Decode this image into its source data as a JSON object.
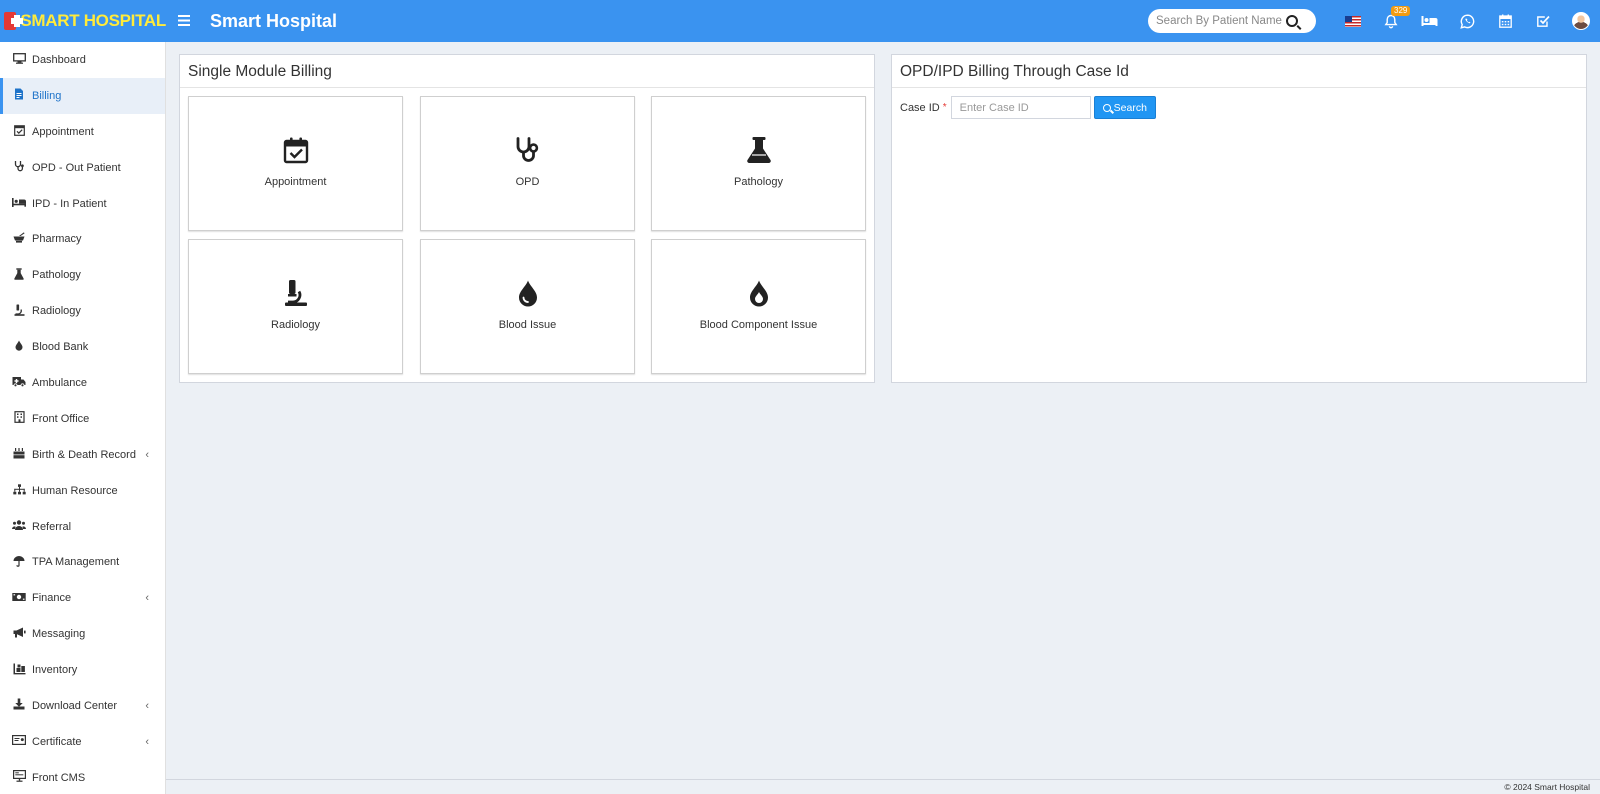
{
  "brand": {
    "text": "SMART HOSPITAL"
  },
  "header": {
    "title": "Smart Hospital",
    "search_placeholder": "Search By Patient Name",
    "notification_count": "329",
    "icons": [
      "flag-us-icon",
      "bell-icon",
      "bed-icon",
      "whatsapp-icon",
      "calendar-icon",
      "check-square-icon",
      "user-avatar"
    ]
  },
  "sidebar": {
    "items": [
      {
        "label": "Dashboard",
        "icon": "desktop-icon"
      },
      {
        "label": "Billing",
        "icon": "file-invoice-icon",
        "active": true
      },
      {
        "label": "Appointment",
        "icon": "calendar-check-icon"
      },
      {
        "label": "OPD - Out Patient",
        "icon": "stethoscope-icon"
      },
      {
        "label": "IPD - In Patient",
        "icon": "bed-icon"
      },
      {
        "label": "Pharmacy",
        "icon": "mortar-pestle-icon"
      },
      {
        "label": "Pathology",
        "icon": "flask-icon"
      },
      {
        "label": "Radiology",
        "icon": "microscope-icon"
      },
      {
        "label": "Blood Bank",
        "icon": "tint-icon"
      },
      {
        "label": "Ambulance",
        "icon": "ambulance-icon"
      },
      {
        "label": "Front Office",
        "icon": "building-icon"
      },
      {
        "label": "Birth & Death Record",
        "icon": "birthday-cake-icon",
        "expandable": true
      },
      {
        "label": "Human Resource",
        "icon": "sitemap-icon"
      },
      {
        "label": "Referral",
        "icon": "users-icon"
      },
      {
        "label": "TPA Management",
        "icon": "umbrella-icon"
      },
      {
        "label": "Finance",
        "icon": "money-bill-icon",
        "expandable": true
      },
      {
        "label": "Messaging",
        "icon": "bullhorn-icon"
      },
      {
        "label": "Inventory",
        "icon": "boxes-icon"
      },
      {
        "label": "Download Center",
        "icon": "download-icon",
        "expandable": true
      },
      {
        "label": "Certificate",
        "icon": "certificate-icon",
        "expandable": true
      },
      {
        "label": "Front CMS",
        "icon": "cms-icon"
      }
    ]
  },
  "single_module": {
    "title": "Single Module Billing",
    "tiles": [
      {
        "label": "Appointment",
        "icon": "calendar-check-icon"
      },
      {
        "label": "OPD",
        "icon": "stethoscope-icon"
      },
      {
        "label": "Pathology",
        "icon": "flask-icon"
      },
      {
        "label": "Radiology",
        "icon": "microscope-icon"
      },
      {
        "label": "Blood Issue",
        "icon": "tint-icon"
      },
      {
        "label": "Blood Component Issue",
        "icon": "burn-icon"
      }
    ]
  },
  "case_billing": {
    "title": "OPD/IPD Billing Through Case Id",
    "case_label": "Case ID",
    "required_mark": "*",
    "case_placeholder": "Enter Case ID",
    "search_label": "Search"
  },
  "footer": {
    "copyright": "© 2024 Smart Hospital"
  },
  "colors": {
    "topbar": "#3a93f0",
    "brand_text": "#ffeb3b",
    "accent": "#2196f3",
    "background": "#ecf0f5",
    "badge": "#f39c12"
  }
}
